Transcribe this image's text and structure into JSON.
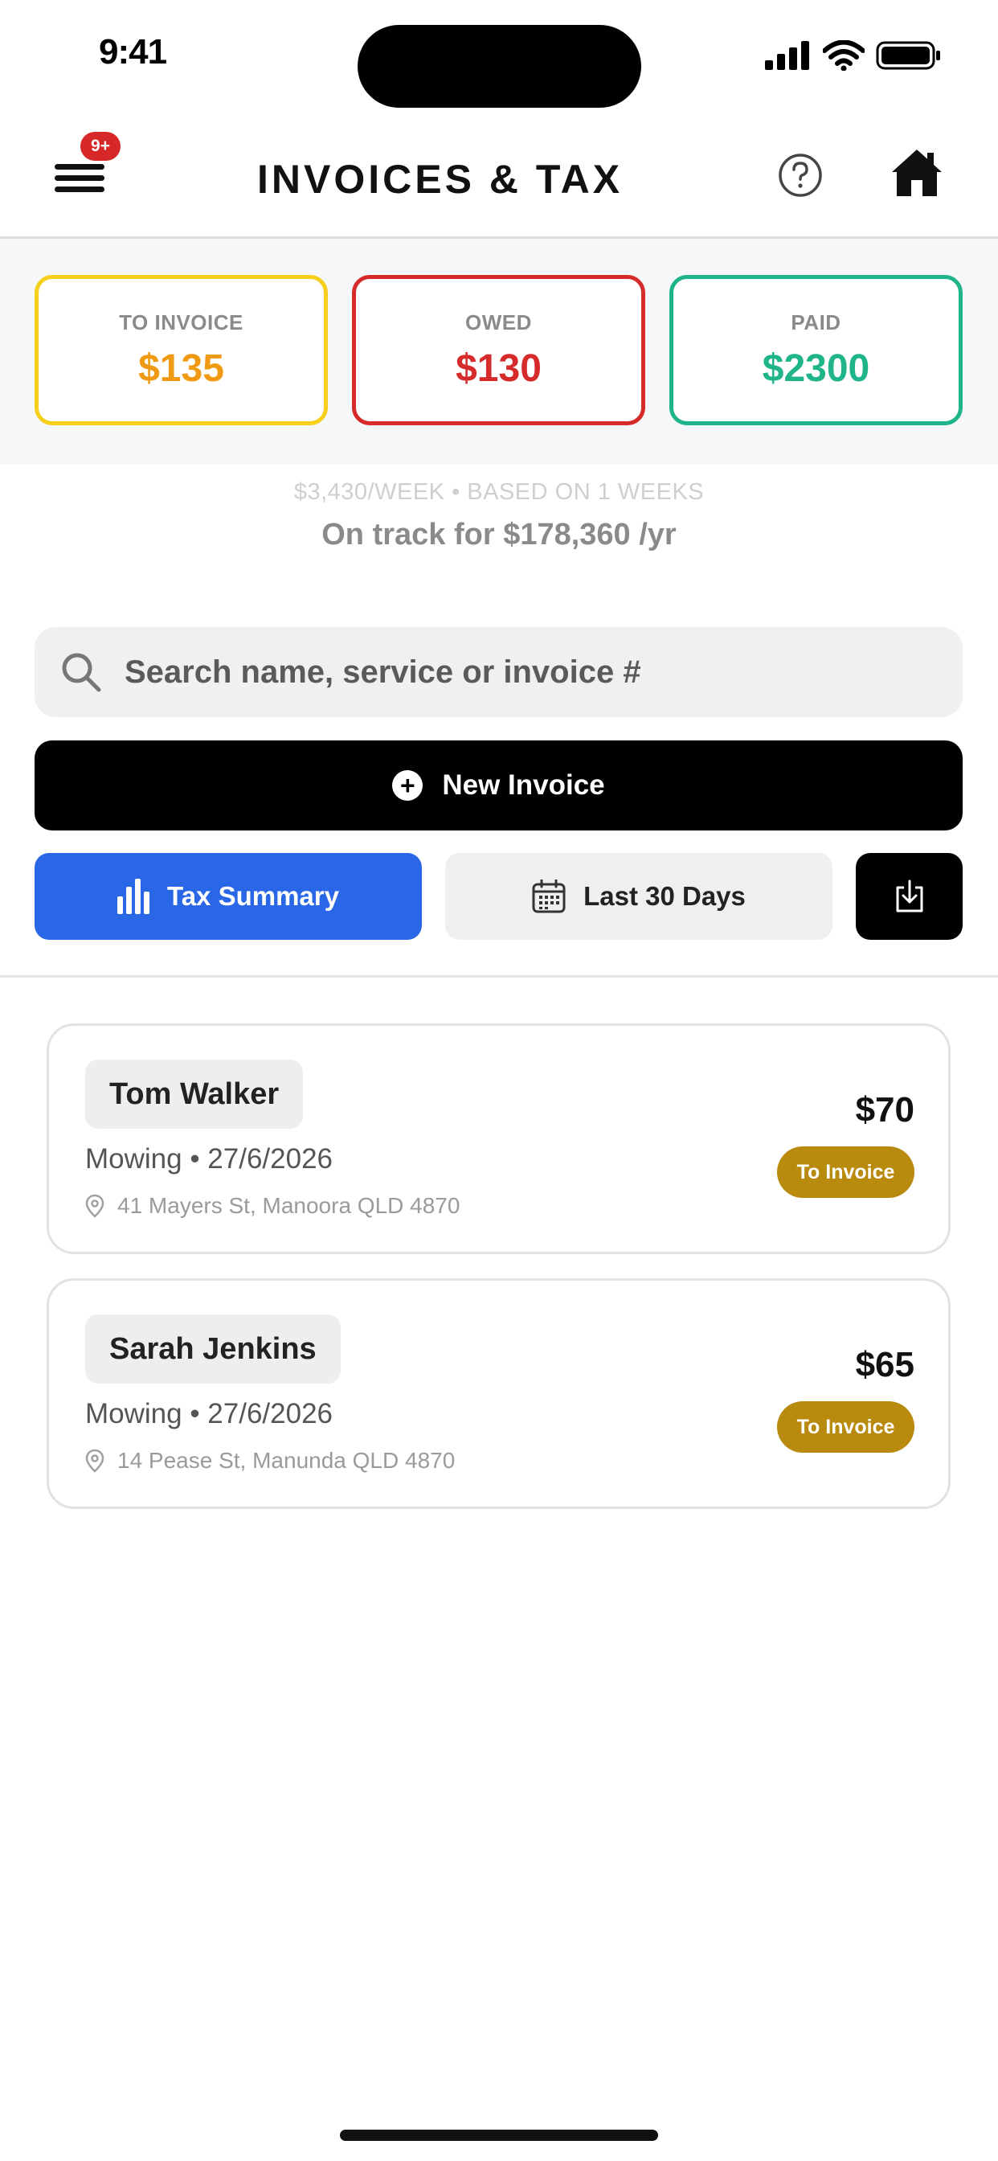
{
  "status_bar": {
    "time": "9:41"
  },
  "header": {
    "title": "INVOICES & TAX",
    "menu_badge": "9+",
    "icons": {
      "menu": "hamburger-menu-icon",
      "help": "help-circle-icon",
      "home": "home-icon"
    }
  },
  "summary": {
    "to_invoice": {
      "label": "TO INVOICE",
      "value": "$135",
      "color": "#f09a14"
    },
    "owed": {
      "label": "OWED",
      "value": "$130",
      "color": "#d62b2b"
    },
    "paid": {
      "label": "PAID",
      "value": "$2300",
      "color": "#1fb48a"
    }
  },
  "projection": {
    "subtitle": "$3,430/WEEK • BASED ON 1 WEEKS",
    "main": "On track for $178,360 /yr"
  },
  "search": {
    "placeholder": "Search name, service or invoice #",
    "value": ""
  },
  "actions": {
    "new_invoice": "New Invoice",
    "tax_summary": "Tax Summary",
    "date_range": "Last 30 Days",
    "export_icon": "download-icon"
  },
  "invoices": [
    {
      "name": "Tom Walker",
      "service_date": "Mowing • 27/6/2026",
      "address": "41 Mayers St, Manoora QLD 4870",
      "amount": "$70",
      "status": "To Invoice"
    },
    {
      "name": "Sarah Jenkins",
      "service_date": "Mowing • 27/6/2026",
      "address": "14 Pease St, Manunda QLD 4870",
      "amount": "$65",
      "status": "To Invoice"
    }
  ],
  "colors": {
    "accent_blue": "#2a67e6",
    "status_pill": "#b88a0e"
  }
}
